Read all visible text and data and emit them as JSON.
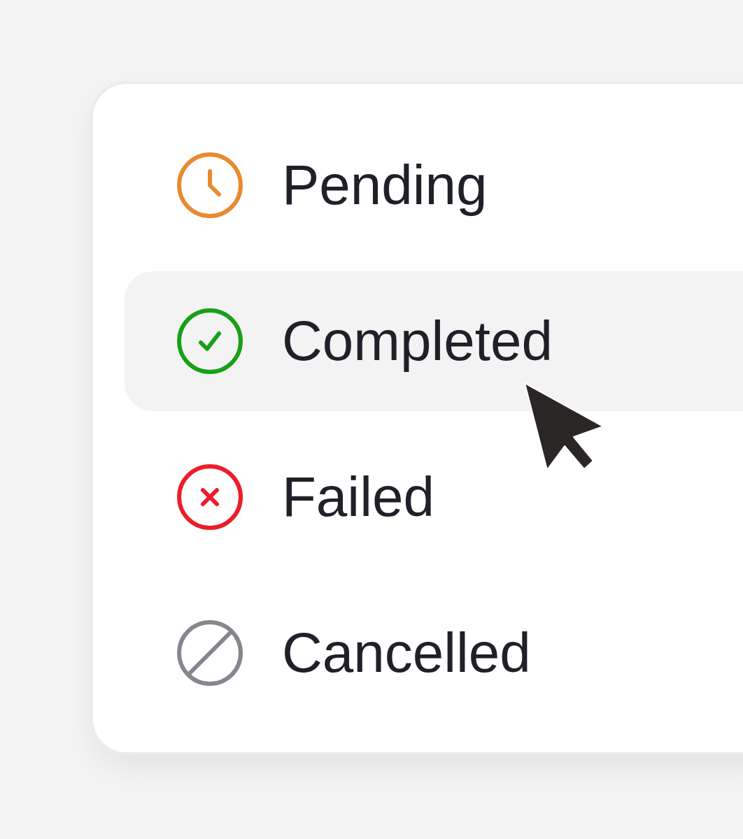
{
  "status_menu": {
    "items": [
      {
        "kind": "pending",
        "label": "Pending",
        "color": "#e88a2e",
        "hovered": false
      },
      {
        "kind": "completed",
        "label": "Completed",
        "color": "#18a018",
        "hovered": true
      },
      {
        "kind": "failed",
        "label": "Failed",
        "color": "#ee1c2a",
        "hovered": false
      },
      {
        "kind": "cancelled",
        "label": "Cancelled",
        "color": "#86868e",
        "hovered": false
      }
    ]
  }
}
